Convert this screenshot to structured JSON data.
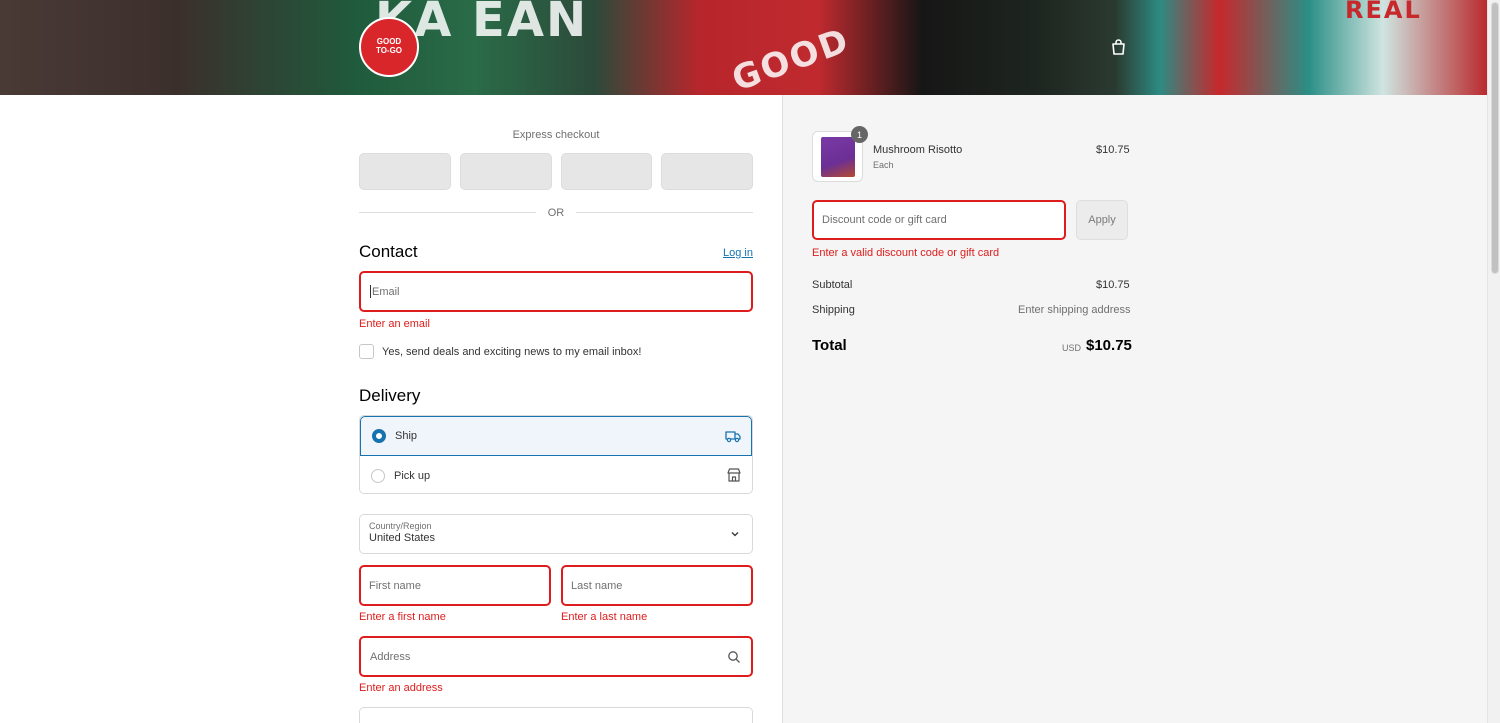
{
  "brand": {
    "logo_text": "GOOD TO-GO"
  },
  "banner": {
    "pkg_text_1": "KA  EAN",
    "pkg_text_2": "GOOD",
    "pkg_text_3": "REAL"
  },
  "express": {
    "label": "Express checkout",
    "or": "OR"
  },
  "contact": {
    "heading": "Contact",
    "login_link": "Log in",
    "email_placeholder": "Email",
    "email_error": "Enter an email",
    "marketing_optin": "Yes, send deals and exciting news to my email inbox!"
  },
  "delivery": {
    "heading": "Delivery",
    "options": [
      {
        "label": "Ship",
        "selected": true,
        "icon": "truck-icon"
      },
      {
        "label": "Pick up",
        "selected": false,
        "icon": "store-icon"
      }
    ],
    "country_label": "Country/Region",
    "country_value": "United States",
    "first_name_placeholder": "First name",
    "first_name_error": "Enter a first name",
    "last_name_placeholder": "Last name",
    "last_name_error": "Enter a last name",
    "address_placeholder": "Address",
    "address_error": "Enter an address"
  },
  "summary": {
    "item": {
      "name": "Mushroom Risotto",
      "variant": "Each",
      "price": "$10.75",
      "quantity": "1"
    },
    "discount_placeholder": "Discount code or gift card",
    "apply_label": "Apply",
    "discount_error": "Enter a valid discount code or gift card",
    "subtotal_label": "Subtotal",
    "subtotal_value": "$10.75",
    "shipping_label": "Shipping",
    "shipping_value": "Enter shipping address",
    "total_label": "Total",
    "currency": "USD",
    "total_value": "$10.75"
  },
  "colors": {
    "accent": "#1773b0",
    "error": "#dd1d1d",
    "brand_red": "#d9262b"
  }
}
